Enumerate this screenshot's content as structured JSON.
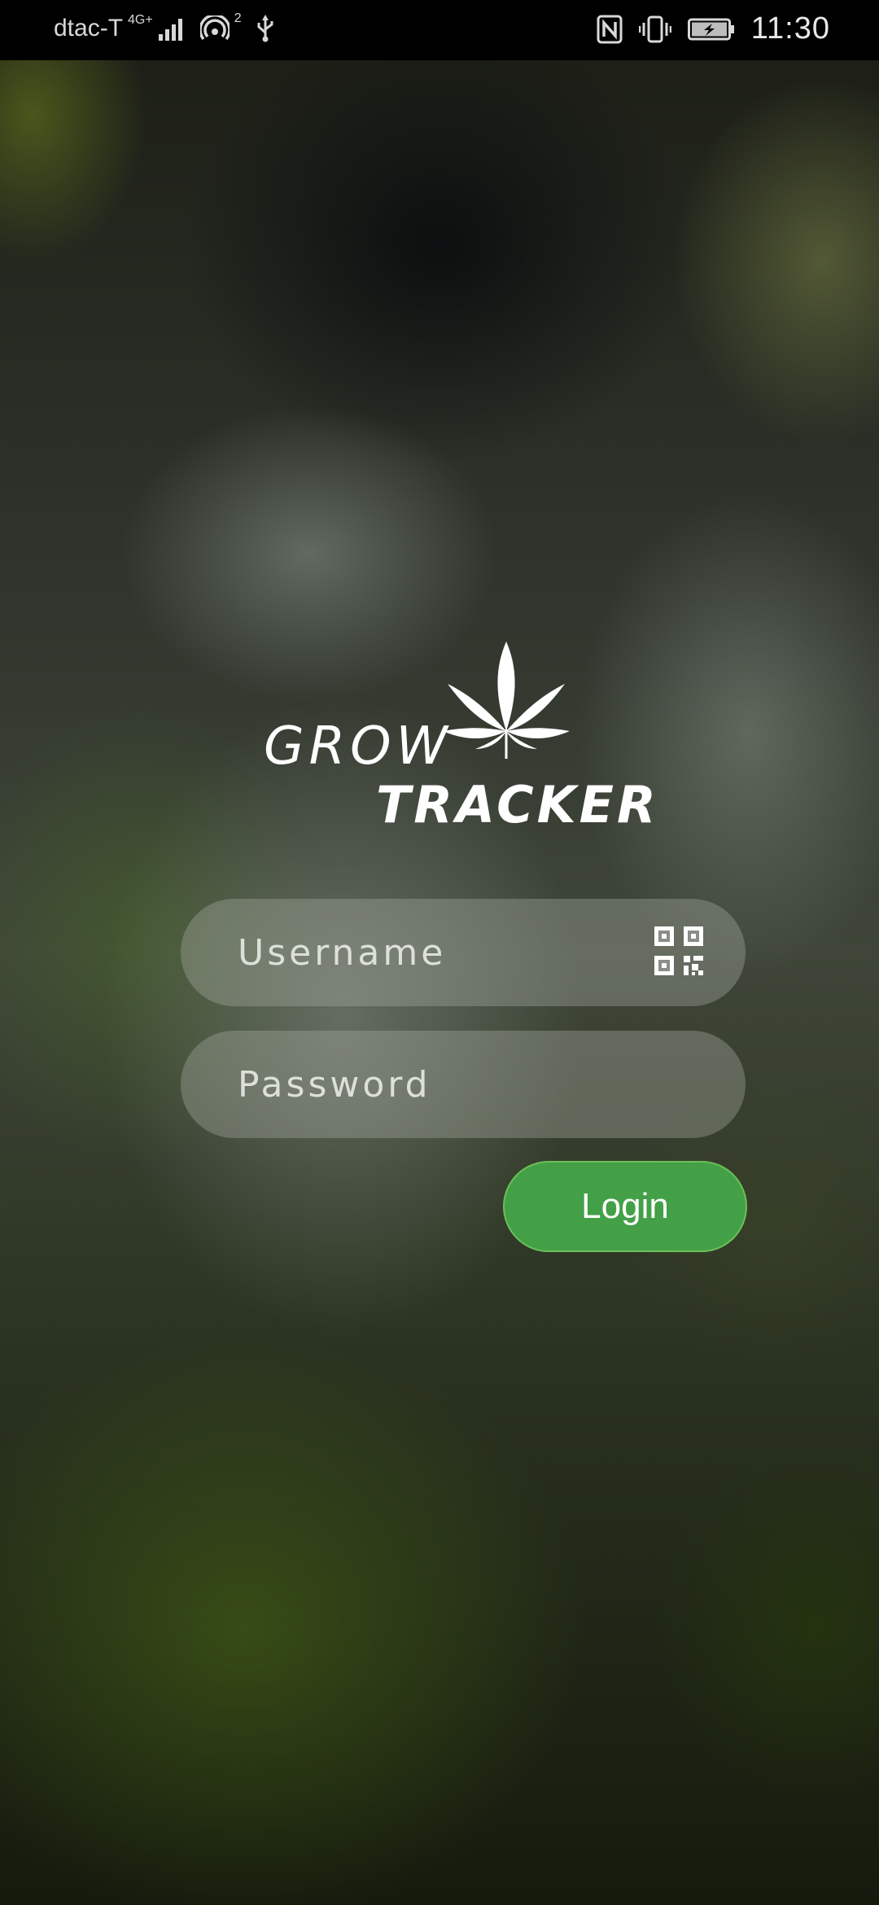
{
  "status_bar": {
    "carrier": "dtac-T",
    "network_type": "4G+",
    "hotspot_count": "2",
    "time": "11:30",
    "icons": [
      "signal-icon",
      "hotspot-icon",
      "usb-icon",
      "nfc-icon",
      "vibrate-icon",
      "battery-charging-icon"
    ]
  },
  "logo": {
    "line1": "GROW",
    "line2": "TRACKER",
    "icon": "cannabis-leaf-icon"
  },
  "login_form": {
    "username_placeholder": "Username",
    "password_placeholder": "Password",
    "qr_icon": "qr-code-icon",
    "login_label": "Login"
  },
  "colors": {
    "accent": "#43a047",
    "status_bar_bg": "#000000",
    "text": "#ffffff"
  }
}
